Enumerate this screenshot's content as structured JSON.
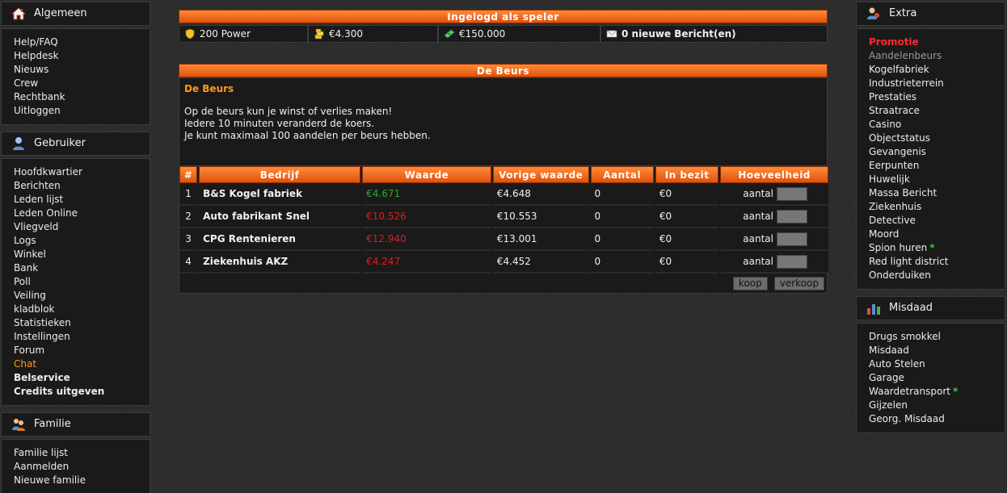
{
  "left": {
    "algemeen": {
      "title": "Algemeen",
      "items": [
        "Help/FAQ",
        "Helpdesk",
        "Nieuws",
        "Crew",
        "Rechtbank",
        "Uitloggen"
      ]
    },
    "gebruiker": {
      "title": "Gebruiker",
      "items": [
        "Hoofdkwartier",
        "Berichten",
        "Leden lijst",
        "Leden Online",
        "Vliegveld",
        "Logs",
        "Winkel",
        "Bank",
        "Poll",
        "Veiling",
        "kladblok",
        "Statistieken",
        "Instellingen",
        "Forum",
        "Chat",
        "Belservice",
        "Credits uitgeven"
      ]
    },
    "familie": {
      "title": "Familie",
      "items": [
        "Familie lijst",
        "Aanmelden",
        "Nieuwe familie"
      ]
    }
  },
  "right": {
    "extra": {
      "title": "Extra",
      "items": [
        "Promotie",
        "Aandelenbeurs",
        "Kogelfabriek",
        "Industrieterrein",
        "Prestaties",
        "Straatrace",
        "Casino",
        "Objectstatus",
        "Gevangenis",
        "Eerpunten",
        "Huwelijk",
        "Massa Bericht",
        "Ziekenhuis",
        "Detective",
        "Moord",
        "Spion huren",
        "Red light district",
        "Onderduiken"
      ],
      "star": "*"
    },
    "misdaad": {
      "title": "Misdaad",
      "items": [
        "Drugs smokkel",
        "Misdaad",
        "Auto Stelen",
        "Garage",
        "Waardetransport",
        "Gijzelen",
        "Georg. Misdaad"
      ],
      "star": "*"
    }
  },
  "header": {
    "title": "Ingelogd als speler",
    "power": "200 Power",
    "cash": "€4.300",
    "bank": "€150.000",
    "messages": "0 nieuwe Bericht(en)"
  },
  "beurs": {
    "bar_title": "De Beurs",
    "title": "De Beurs",
    "lines": [
      "Op de beurs kun je winst of verlies maken!",
      "Iedere 10 minuten veranderd de koers.",
      "Je kunt maximaal 100 aandelen per beurs hebben."
    ],
    "columns": [
      "#",
      "Bedrijf",
      "Waarde",
      "Vorige waarde",
      "Aantal",
      "In bezit",
      "Hoeveelheid"
    ],
    "rows": [
      {
        "num": "1",
        "name": "B&S Kogel fabriek",
        "value": "€4.671",
        "prev": "€4.648",
        "count": "0",
        "owned": "€0",
        "qty_label": "aantal"
      },
      {
        "num": "2",
        "name": "Auto fabrikant Snel",
        "value": "€10.526",
        "prev": "€10.553",
        "count": "0",
        "owned": "€0",
        "qty_label": "aantal"
      },
      {
        "num": "3",
        "name": "CPG Rentenieren",
        "value": "€12.940",
        "prev": "€13.001",
        "count": "0",
        "owned": "€0",
        "qty_label": "aantal"
      },
      {
        "num": "4",
        "name": "Ziekenhuis AKZ",
        "value": "€4.247",
        "prev": "€4.452",
        "count": "0",
        "owned": "€0",
        "qty_label": "aantal"
      }
    ],
    "buy_label": "koop",
    "sell_label": "verkoop"
  },
  "colors": {
    "accent": "#ff9a1a",
    "header_orange": "#e0520c",
    "up_green": "#2ea82e",
    "down_red": "#e01e1e",
    "promo_red": "#ff2a2a"
  }
}
